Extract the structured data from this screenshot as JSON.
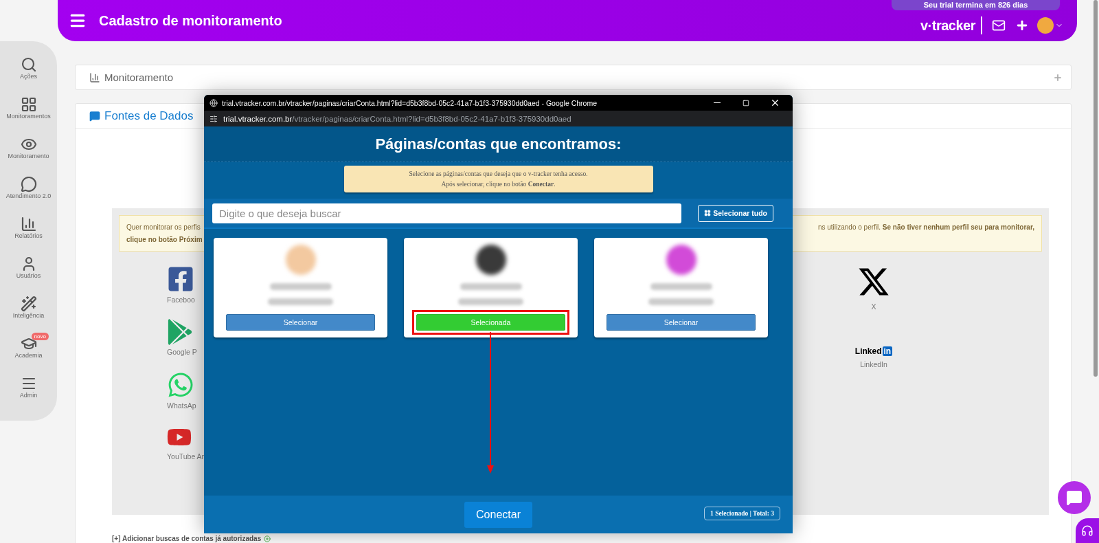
{
  "header": {
    "title": "Cadastro de monitoramento",
    "trial": "Seu trial termina em 826 dias",
    "logo": "v·tracker"
  },
  "sidebar": {
    "items": [
      {
        "kind": "search",
        "label": "Ações"
      },
      {
        "kind": "grid",
        "label": "Monitoramentos"
      },
      {
        "kind": "eye",
        "label": "Monitoramento"
      },
      {
        "kind": "chat",
        "label": "Atendimento 2.0"
      },
      {
        "kind": "chart",
        "label": "Relatórios"
      },
      {
        "kind": "user",
        "label": "Usuários"
      },
      {
        "kind": "wand",
        "label": "Inteligência"
      },
      {
        "kind": "cap",
        "label": "Academia",
        "badge": "novo"
      },
      {
        "kind": "menu",
        "label": "Admin"
      }
    ]
  },
  "monitor_panel": {
    "title": "Monitoramento"
  },
  "sources_panel": {
    "title": "Fontes de Dados",
    "alert_left": [
      {
        "text": "Quer monitorar os perfis",
        "bold": false
      },
      {
        "text": "clique no botão Próxim",
        "bold": true
      }
    ],
    "alert_right": "ns utilizando o perfil. **Se não tiver nenhum perfil seu para monitorar,**",
    "platforms_left": [
      {
        "kind": "facebook",
        "label": "Faceboo"
      },
      {
        "kind": "play",
        "label": "Google P"
      },
      {
        "kind": "whatsapp",
        "label": "WhatsAp"
      },
      {
        "kind": "youtube",
        "label": "YouTube An"
      }
    ],
    "platforms_right": [
      {
        "kind": "x",
        "label": "X"
      },
      {
        "kind": "linkedin",
        "logo_text": "Linked",
        "logo_badge": "in",
        "label": "LinkedIn"
      }
    ],
    "footer_link": "[+] Adicionar buscas de contas já autorizadas"
  },
  "popup": {
    "window_title": "trial.vtracker.com.br/vtracker/paginas/criarConta.html?lid=d5b3f8bd-05c2-41a7-b1f3-375930dd0aed - Google Chrome",
    "url_host": "trial.vtracker.com.br",
    "url_path": "/vtracker/paginas/criarConta.html?lid=d5b3f8bd-05c2-41a7-b1f3-375930dd0aed",
    "heading": "Páginas/contas que encontramos:",
    "notice": [
      "Selecione as páginas/contas que deseja que o v-tracker tenha acesso.",
      "Após selecionar, clique no botão **Conectar**."
    ],
    "search_placeholder": "Digite o que deseja buscar",
    "select_all": "Selecionar tudo",
    "cards": [
      {
        "color": "#f3c9a0",
        "button": "Selecionar",
        "selected": false,
        "highlighted": false
      },
      {
        "color": "#3a3a3a",
        "button": "Selecionada",
        "selected": true,
        "highlighted": true
      },
      {
        "color": "#d24bd8",
        "button": "Selecionar",
        "selected": false,
        "highlighted": false
      }
    ],
    "connect": "Conectar",
    "counter": "1 Selecionado | Total: 3"
  }
}
